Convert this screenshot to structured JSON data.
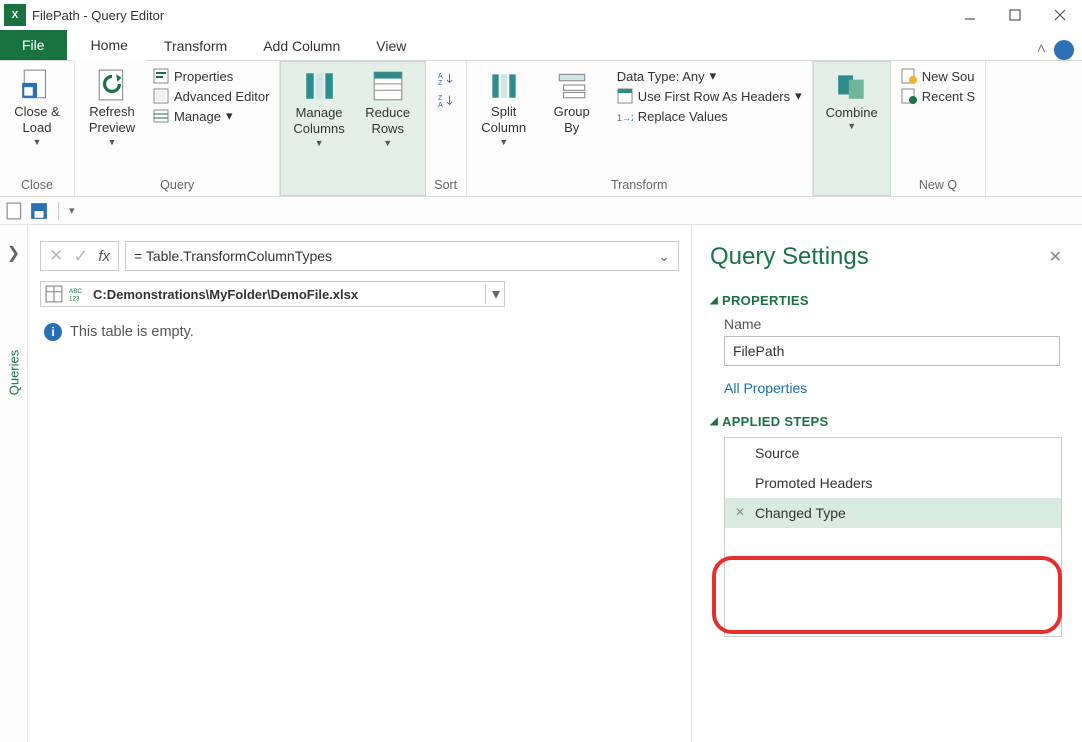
{
  "window": {
    "title": "FilePath - Query Editor",
    "min_tt": "Minimize",
    "max_tt": "Maximize",
    "close_tt": "Close"
  },
  "tabs": {
    "file": "File",
    "home": "Home",
    "transform": "Transform",
    "addcol": "Add Column",
    "view": "View"
  },
  "ribbon": {
    "close": {
      "close_load": "Close &\nLoad",
      "group": "Close"
    },
    "query": {
      "refresh": "Refresh\nPreview",
      "properties": "Properties",
      "advanced": "Advanced Editor",
      "manage": "Manage",
      "group": "Query"
    },
    "manage_cols": "Manage\nColumns",
    "reduce_rows": "Reduce\nRows",
    "sort": "Sort",
    "split_col": "Split\nColumn",
    "group_by": "Group\nBy",
    "data_type": "Data Type: Any",
    "first_row": "Use First Row As Headers",
    "replace": "Replace Values",
    "transform_group": "Transform",
    "combine": "Combine",
    "new_source": "New Sou",
    "recent": "Recent S",
    "new_q": "New Q"
  },
  "formula": {
    "text": "= Table.TransformColumnTypes",
    "col_header": "C:Demonstrations\\MyFolder\\DemoFile.xlsx"
  },
  "editor": {
    "queries_label": "Queries",
    "empty": "This table is empty."
  },
  "settings": {
    "title": "Query Settings",
    "properties_head": "PROPERTIES",
    "name_label": "Name",
    "name_value": "FilePath",
    "all_props": "All Properties",
    "steps_head": "APPLIED STEPS",
    "steps": [
      "Source",
      "Promoted Headers",
      "Changed Type"
    ]
  }
}
